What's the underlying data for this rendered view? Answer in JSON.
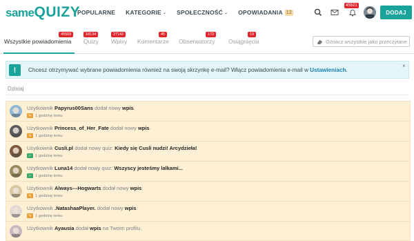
{
  "header": {
    "logo_same": "same",
    "logo_quizy": "QUIZY",
    "nav": [
      {
        "label": "POPULARNE",
        "has_chevron": false
      },
      {
        "label": "KATEGORIE",
        "has_chevron": true
      },
      {
        "label": "SPOŁECZNOŚĆ",
        "has_chevron": true
      },
      {
        "label": "OPOWIADANIA",
        "has_chevron": false,
        "badge": "12"
      }
    ],
    "chevron": "⌄",
    "notifications_badge": "45521",
    "add_label": "DODAJ",
    "accent_color": "#1aa39b"
  },
  "tabs": {
    "items": [
      {
        "label": "Wszystkie powiadomienia",
        "badge": "45509",
        "active": true
      },
      {
        "label": "Quizy",
        "badge": "18134",
        "active": false
      },
      {
        "label": "Wpisy",
        "badge": "27142",
        "active": false
      },
      {
        "label": "Komentarze",
        "badge": "45",
        "active": false
      },
      {
        "label": "Obserwatorzy",
        "badge": "172",
        "active": false
      },
      {
        "label": "Osiągnięcia",
        "badge": "19",
        "active": false
      }
    ],
    "mark_all_read": "Oznacz wszystkie jako przeczytane"
  },
  "alert": {
    "icon": "!",
    "text": "Chcesz otrzymywać wybrane powiadomienia również na swoją skrzynkę e-mail? Włącz powiadomienia e-mail w ",
    "link": "Ustawieniach",
    "suffix": ".",
    "close": "×"
  },
  "day_label": "Dzisiaj",
  "notifications": [
    {
      "pre": "Użytkownik ",
      "user": "Papyrus00Sans",
      "mid": " dodał nowy ",
      "target": "wpis",
      "post": ".",
      "time": "1 godzinę temu",
      "type": "post",
      "avatar_color": "#8fb8d6"
    },
    {
      "pre": "Użytkownik ",
      "user": "Princess_of_Her_Fate",
      "mid": " dodał nowy ",
      "target": "wpis",
      "post": ".",
      "time": "1 godzinę temu",
      "type": "post",
      "avatar_color": "#5a5a5a"
    },
    {
      "pre": "Użytkownik ",
      "user": "Cusli.pl",
      "mid": " dodał nowy quiz: ",
      "target": "Kiedy się Cusli nudzi! Arcydzieła!",
      "post": "",
      "time": "1 godzinę temu",
      "type": "quiz",
      "avatar_color": "#7a5a3a"
    },
    {
      "pre": "Użytkownik ",
      "user": "Luna14",
      "mid": " dodał nowy quiz: ",
      "target": "Wszyscy jesteśmy lalkami...",
      "post": "",
      "time": "1 godzinę temu",
      "type": "quiz",
      "avatar_color": "#9b8a5a"
    },
    {
      "pre": "Użytkownik ",
      "user": "Always---Hogwarts",
      "mid": " dodał nowy ",
      "target": "wpis",
      "post": ".",
      "time": "1 godzinę temu",
      "type": "post",
      "avatar_color": "#d8c7a0"
    },
    {
      "pre": "Użytkownik ",
      "user": ".NatashaaPlayer.",
      "mid": " dodał nowy ",
      "target": "wpis",
      "post": ".",
      "time": "1 godzinę temu",
      "type": "post",
      "avatar_color": "#e3d9d3"
    },
    {
      "pre": "Użytkownik ",
      "user": "Ayausia",
      "mid": " dodał ",
      "target": "wpis",
      "post": " na Twoim profilu.",
      "time": "",
      "type": "post",
      "avatar_color": "#c9b8c0"
    }
  ]
}
